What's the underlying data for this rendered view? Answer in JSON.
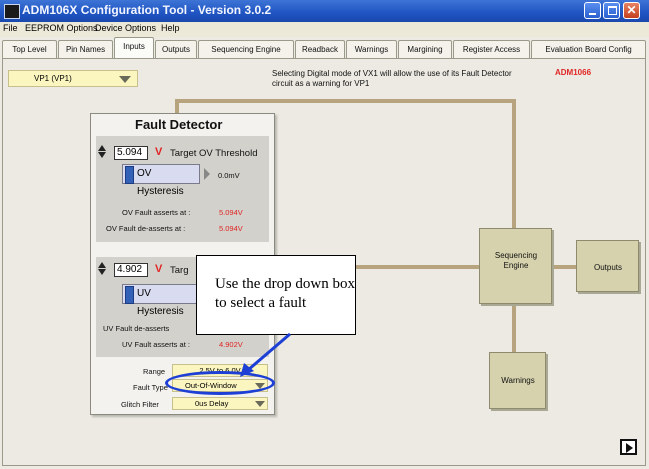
{
  "window": {
    "title": "ADM106X Configuration Tool - Version 3.0.2",
    "min_icon": "minimize-icon",
    "max_icon": "maximize-icon",
    "close_icon": "close-icon",
    "close_glyph": "✕"
  },
  "menu": [
    "File",
    "EEPROM Options",
    "Device Options",
    "Help"
  ],
  "tabs": [
    "Top Level",
    "Pin Names",
    "Inputs",
    "Outputs",
    "Sequencing Engine",
    "Readback",
    "Warnings",
    "Margining",
    "Register Access",
    "Evaluation Board Config"
  ],
  "active_tab": "Inputs",
  "input_select": {
    "value": "VP1  (VP1)"
  },
  "info_text": "Selecting Digital mode of VX1 will allow the use of its Fault Detector circuit as a warning for VP1",
  "device_label": "ADM1066",
  "fault_detector": {
    "title": "Fault Detector",
    "ov": {
      "threshold_value": "5.094",
      "unit": "V",
      "threshold_label": "Target OV Threshold",
      "hysteresis_label": "OV Hysteresis",
      "hysteresis_value": "0.0mV",
      "asserts_label": "OV Fault asserts at :",
      "asserts_value": "5.094V",
      "deasserts_label": "OV Fault de-asserts at :",
      "deasserts_value": "5.094V"
    },
    "uv": {
      "threshold_value": "4.902",
      "unit": "V",
      "threshold_label": "Targ",
      "hysteresis_label": "UV Hysteresis",
      "deasserts_label": "UV Fault de-asserts",
      "asserts_label": "UV Fault asserts at :",
      "asserts_value": "4.902V"
    },
    "range_label": "Range",
    "range_value": "2.5V to 6.0V",
    "fault_type_label": "Fault Type",
    "fault_type_value": "Out-Of-Window",
    "glitch_label": "Glitch Filter",
    "glitch_value": "0us Delay"
  },
  "blocks": {
    "sequencing_engine": "Sequencing Engine",
    "outputs": "Outputs",
    "warnings": "Warnings"
  },
  "callout": "Use the drop down box to select a fault",
  "colors": {
    "accent_red": "#e02525",
    "highlight_blue": "#1d3fd6",
    "block": "#d6d2ad"
  }
}
